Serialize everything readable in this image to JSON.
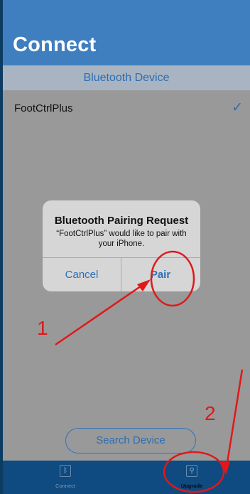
{
  "header": {
    "title": "Connect"
  },
  "section": {
    "label": "Bluetooth Device"
  },
  "devices": [
    {
      "name": "FootCtrlPlus",
      "checked": true
    }
  ],
  "dialog": {
    "title": "Bluetooth Pairing Request",
    "message": "“FootCtrlPlus” would like to pair with your iPhone.",
    "cancel_label": "Cancel",
    "pair_label": "Pair"
  },
  "search_button": {
    "label": "Search Device"
  },
  "tabs": [
    {
      "label": "Connect",
      "icon": "bluetooth-icon"
    },
    {
      "label": "Upgrade",
      "icon": "upgrade-icon"
    }
  ],
  "annotations": {
    "step1": "1",
    "step2": "2"
  },
  "colors": {
    "header": "#3f7fbf",
    "accent": "#2c6fb8",
    "annotation": "#e11818",
    "tabbar": "#0f4a80"
  }
}
